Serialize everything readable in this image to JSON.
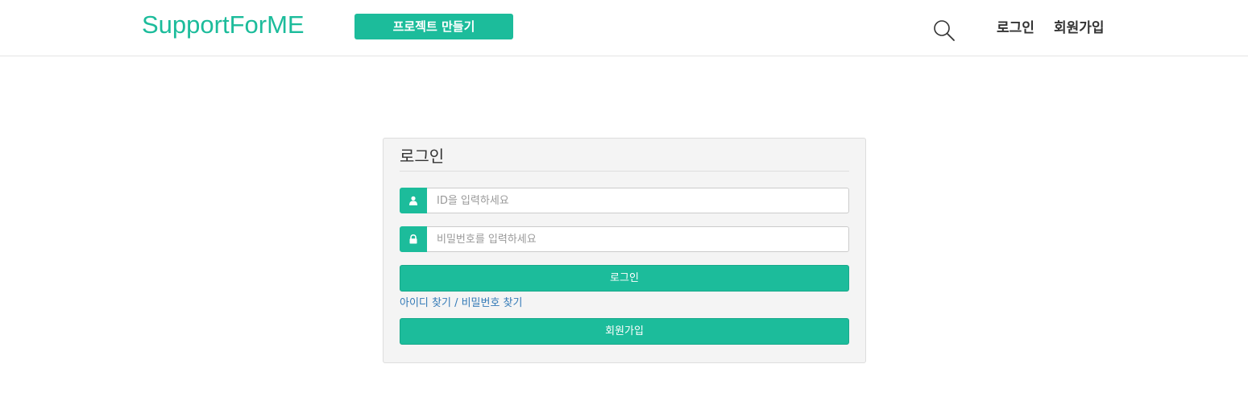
{
  "header": {
    "logo": "SupportForME",
    "create_project_label": "프로젝트 만들기",
    "search_icon": "search-icon",
    "login_label": "로그인",
    "signup_label": "회원가입"
  },
  "login_panel": {
    "title": "로그인",
    "id_field": {
      "icon": "user-icon",
      "value": "",
      "placeholder": "ID을 입력하세요"
    },
    "password_field": {
      "icon": "lock-icon",
      "value": "",
      "placeholder": "비밀번호를 입력하세요"
    },
    "login_button_label": "로그인",
    "find_link_label": "아이디 찾기 / 비밀번호 찾기",
    "signup_button_label": "회원가입"
  },
  "colors": {
    "accent": "#1cbc9b",
    "link": "#337ab7",
    "panel_bg": "#f4f4f4"
  }
}
